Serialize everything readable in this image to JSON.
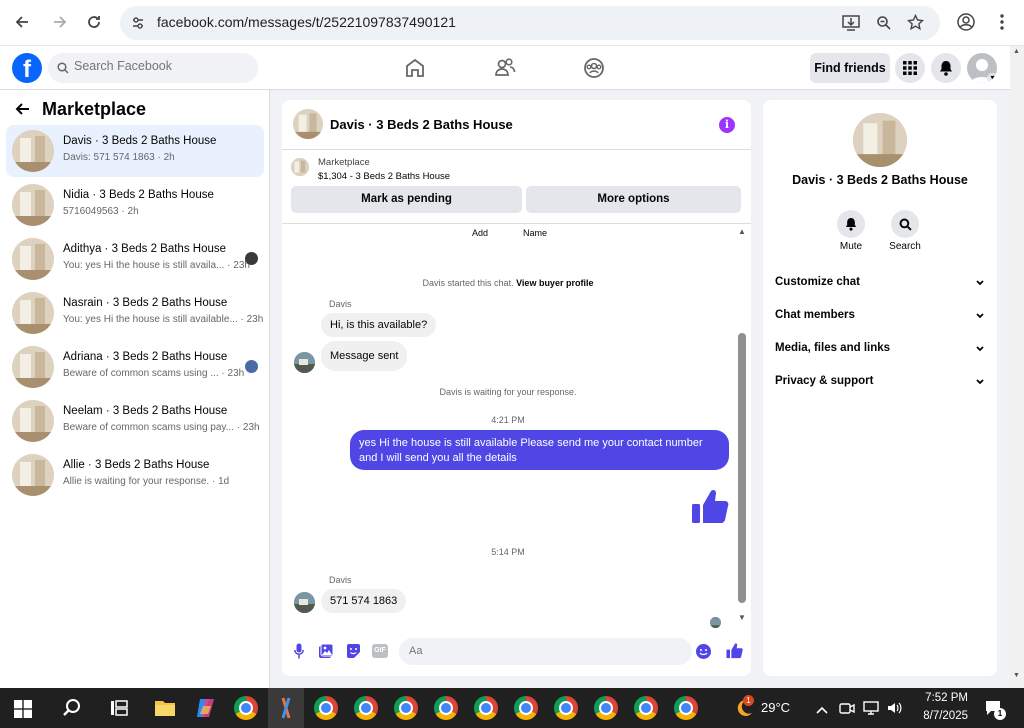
{
  "browser": {
    "url": "facebook.com/messages/t/25221097837490121"
  },
  "header": {
    "search_placeholder": "Search Facebook",
    "find_friends": "Find friends"
  },
  "sidebar": {
    "title": "Marketplace",
    "conversations": [
      {
        "title": "Davis · 3 Beds 2 Baths House",
        "subtitle": "Davis: 571 574 1863 · 2h"
      },
      {
        "title": "Nidia · 3 Beds 2 Baths House",
        "subtitle": "5716049563 · 2h"
      },
      {
        "title": "Adithya · 3 Beds 2 Baths House",
        "subtitle": "You: yes Hi the house is still availa... · 23h"
      },
      {
        "title": "Nasrain · 3 Beds 2 Baths House",
        "subtitle": "You: yes Hi the house is still available... · 23h"
      },
      {
        "title": "Adriana · 3 Beds 2 Baths House",
        "subtitle": "Beware of common scams using ... · 23h"
      },
      {
        "title": "Neelam · 3 Beds 2 Baths House",
        "subtitle": "Beware of common scams using pay... · 23h"
      },
      {
        "title": "Allie · 3 Beds 2 Baths House",
        "subtitle": "Allie is waiting for your response. · 1d"
      }
    ]
  },
  "chat": {
    "title": "Davis · 3 Beds 2 Baths House",
    "listing_label": "Marketplace",
    "listing_detail": "$1,304 - 3 Beds 2 Baths House",
    "mark_pending": "Mark as pending",
    "more_options": "More options",
    "add_label": "Add",
    "name_label": "Name",
    "started_text": "Davis started this chat.",
    "view_profile": "View buyer profile",
    "sender_name": "Davis",
    "msg1": "Hi, is this available?",
    "msg2": "Message sent",
    "waiting_text": "Davis is waiting for your response.",
    "time1": "4:21 PM",
    "out_msg": "yes Hi the house is still available Please send me your contact number and I will send you all the details",
    "time2": "5:14 PM",
    "sender_name2": "Davis",
    "msg3": "571 574 1863",
    "composer_placeholder": "Aa"
  },
  "details": {
    "title": "Davis · 3 Beds 2 Baths House",
    "mute": "Mute",
    "search": "Search",
    "sections": [
      "Customize chat",
      "Chat members",
      "Media, files and links",
      "Privacy & support"
    ]
  },
  "taskbar": {
    "weather_badge": "1",
    "temperature": "29°C",
    "time": "7:52 PM",
    "date": "8/7/2025",
    "notif_count": "1"
  }
}
